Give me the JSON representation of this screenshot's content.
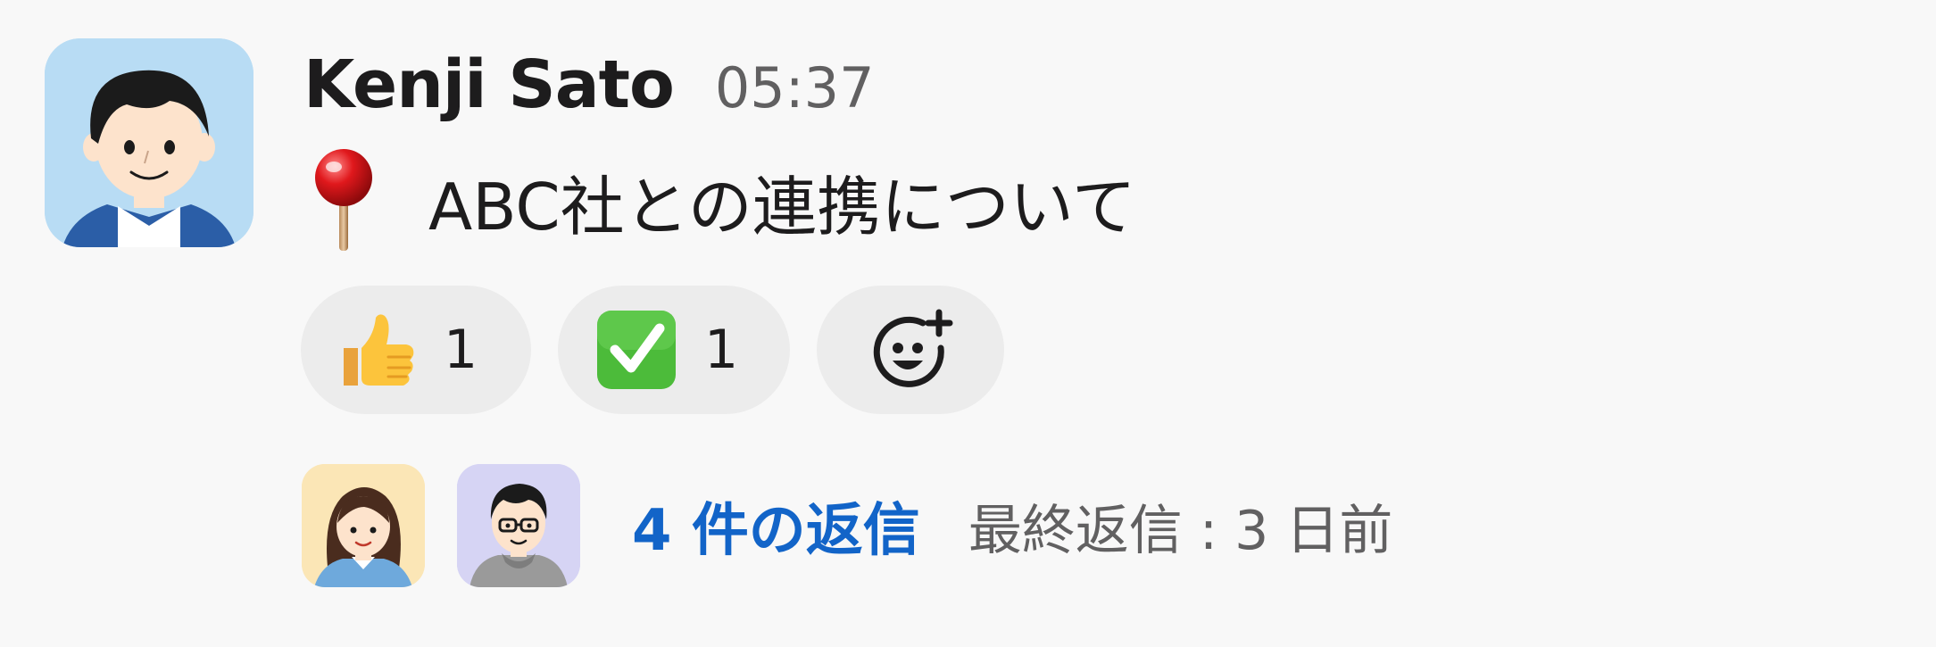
{
  "message": {
    "author": "Kenji Sato",
    "timestamp": "05:37",
    "pin_emoji": "pushpin-icon",
    "text": "ABC社との連携について"
  },
  "reactions": [
    {
      "emoji": "thumbs-up-icon",
      "count": "1"
    },
    {
      "emoji": "check-mark-icon",
      "count": "1"
    },
    {
      "emoji": "add-reaction-icon"
    }
  ],
  "thread": {
    "reply_count": "4 件の返信",
    "last_reply": "最終返信 : 3 日前"
  },
  "colors": {
    "link_blue": "#1264c8",
    "muted_text": "#616061",
    "pill_background": "#ececec",
    "main_avatar_background": "#b8dcf4"
  }
}
